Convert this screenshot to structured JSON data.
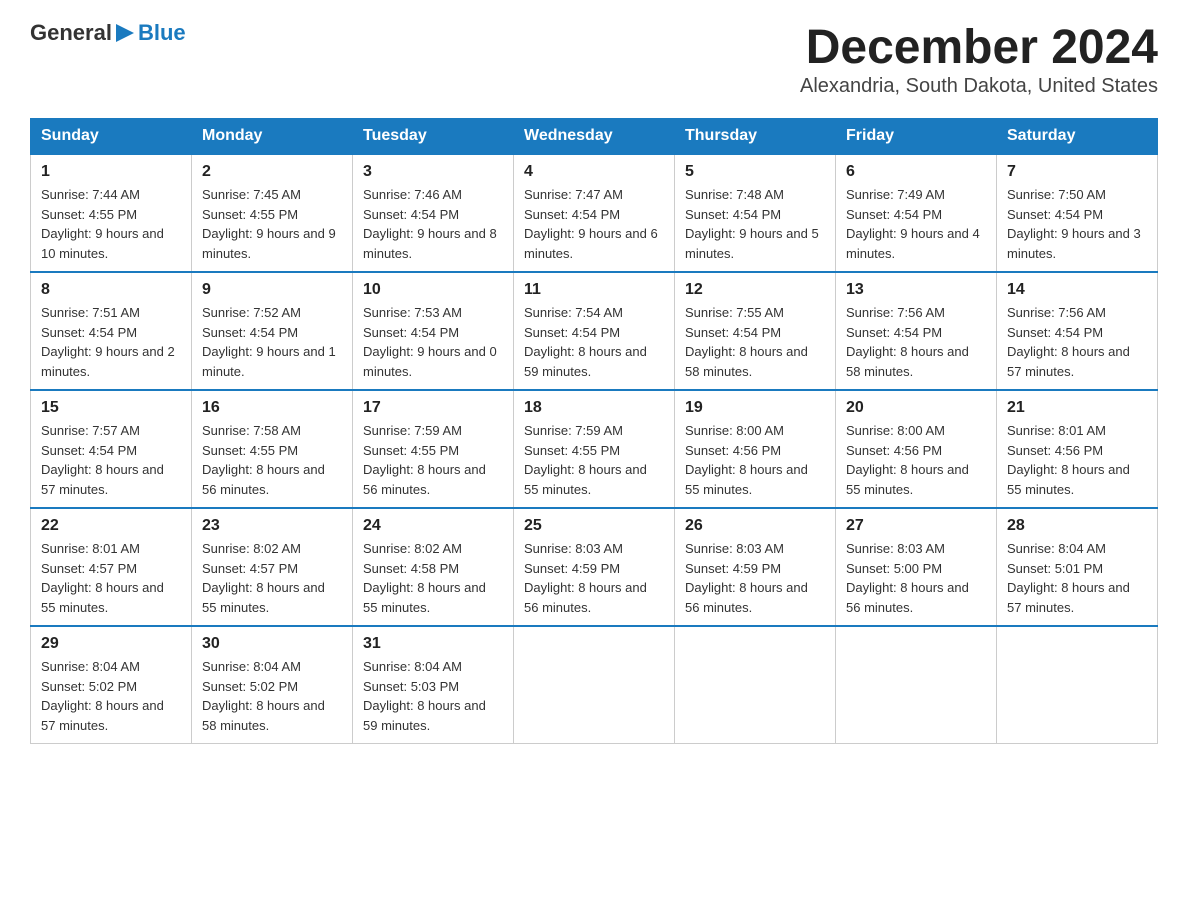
{
  "header": {
    "logo_general": "General",
    "logo_blue": "Blue",
    "month_title": "December 2024",
    "location": "Alexandria, South Dakota, United States"
  },
  "days_of_week": [
    "Sunday",
    "Monday",
    "Tuesday",
    "Wednesday",
    "Thursday",
    "Friday",
    "Saturday"
  ],
  "weeks": [
    [
      {
        "day": "1",
        "sunrise": "7:44 AM",
        "sunset": "4:55 PM",
        "daylight": "9 hours and 10 minutes."
      },
      {
        "day": "2",
        "sunrise": "7:45 AM",
        "sunset": "4:55 PM",
        "daylight": "9 hours and 9 minutes."
      },
      {
        "day": "3",
        "sunrise": "7:46 AM",
        "sunset": "4:54 PM",
        "daylight": "9 hours and 8 minutes."
      },
      {
        "day": "4",
        "sunrise": "7:47 AM",
        "sunset": "4:54 PM",
        "daylight": "9 hours and 6 minutes."
      },
      {
        "day": "5",
        "sunrise": "7:48 AM",
        "sunset": "4:54 PM",
        "daylight": "9 hours and 5 minutes."
      },
      {
        "day": "6",
        "sunrise": "7:49 AM",
        "sunset": "4:54 PM",
        "daylight": "9 hours and 4 minutes."
      },
      {
        "day": "7",
        "sunrise": "7:50 AM",
        "sunset": "4:54 PM",
        "daylight": "9 hours and 3 minutes."
      }
    ],
    [
      {
        "day": "8",
        "sunrise": "7:51 AM",
        "sunset": "4:54 PM",
        "daylight": "9 hours and 2 minutes."
      },
      {
        "day": "9",
        "sunrise": "7:52 AM",
        "sunset": "4:54 PM",
        "daylight": "9 hours and 1 minute."
      },
      {
        "day": "10",
        "sunrise": "7:53 AM",
        "sunset": "4:54 PM",
        "daylight": "9 hours and 0 minutes."
      },
      {
        "day": "11",
        "sunrise": "7:54 AM",
        "sunset": "4:54 PM",
        "daylight": "8 hours and 59 minutes."
      },
      {
        "day": "12",
        "sunrise": "7:55 AM",
        "sunset": "4:54 PM",
        "daylight": "8 hours and 58 minutes."
      },
      {
        "day": "13",
        "sunrise": "7:56 AM",
        "sunset": "4:54 PM",
        "daylight": "8 hours and 58 minutes."
      },
      {
        "day": "14",
        "sunrise": "7:56 AM",
        "sunset": "4:54 PM",
        "daylight": "8 hours and 57 minutes."
      }
    ],
    [
      {
        "day": "15",
        "sunrise": "7:57 AM",
        "sunset": "4:54 PM",
        "daylight": "8 hours and 57 minutes."
      },
      {
        "day": "16",
        "sunrise": "7:58 AM",
        "sunset": "4:55 PM",
        "daylight": "8 hours and 56 minutes."
      },
      {
        "day": "17",
        "sunrise": "7:59 AM",
        "sunset": "4:55 PM",
        "daylight": "8 hours and 56 minutes."
      },
      {
        "day": "18",
        "sunrise": "7:59 AM",
        "sunset": "4:55 PM",
        "daylight": "8 hours and 55 minutes."
      },
      {
        "day": "19",
        "sunrise": "8:00 AM",
        "sunset": "4:56 PM",
        "daylight": "8 hours and 55 minutes."
      },
      {
        "day": "20",
        "sunrise": "8:00 AM",
        "sunset": "4:56 PM",
        "daylight": "8 hours and 55 minutes."
      },
      {
        "day": "21",
        "sunrise": "8:01 AM",
        "sunset": "4:56 PM",
        "daylight": "8 hours and 55 minutes."
      }
    ],
    [
      {
        "day": "22",
        "sunrise": "8:01 AM",
        "sunset": "4:57 PM",
        "daylight": "8 hours and 55 minutes."
      },
      {
        "day": "23",
        "sunrise": "8:02 AM",
        "sunset": "4:57 PM",
        "daylight": "8 hours and 55 minutes."
      },
      {
        "day": "24",
        "sunrise": "8:02 AM",
        "sunset": "4:58 PM",
        "daylight": "8 hours and 55 minutes."
      },
      {
        "day": "25",
        "sunrise": "8:03 AM",
        "sunset": "4:59 PM",
        "daylight": "8 hours and 56 minutes."
      },
      {
        "day": "26",
        "sunrise": "8:03 AM",
        "sunset": "4:59 PM",
        "daylight": "8 hours and 56 minutes."
      },
      {
        "day": "27",
        "sunrise": "8:03 AM",
        "sunset": "5:00 PM",
        "daylight": "8 hours and 56 minutes."
      },
      {
        "day": "28",
        "sunrise": "8:04 AM",
        "sunset": "5:01 PM",
        "daylight": "8 hours and 57 minutes."
      }
    ],
    [
      {
        "day": "29",
        "sunrise": "8:04 AM",
        "sunset": "5:02 PM",
        "daylight": "8 hours and 57 minutes."
      },
      {
        "day": "30",
        "sunrise": "8:04 AM",
        "sunset": "5:02 PM",
        "daylight": "8 hours and 58 minutes."
      },
      {
        "day": "31",
        "sunrise": "8:04 AM",
        "sunset": "5:03 PM",
        "daylight": "8 hours and 59 minutes."
      },
      null,
      null,
      null,
      null
    ]
  ]
}
